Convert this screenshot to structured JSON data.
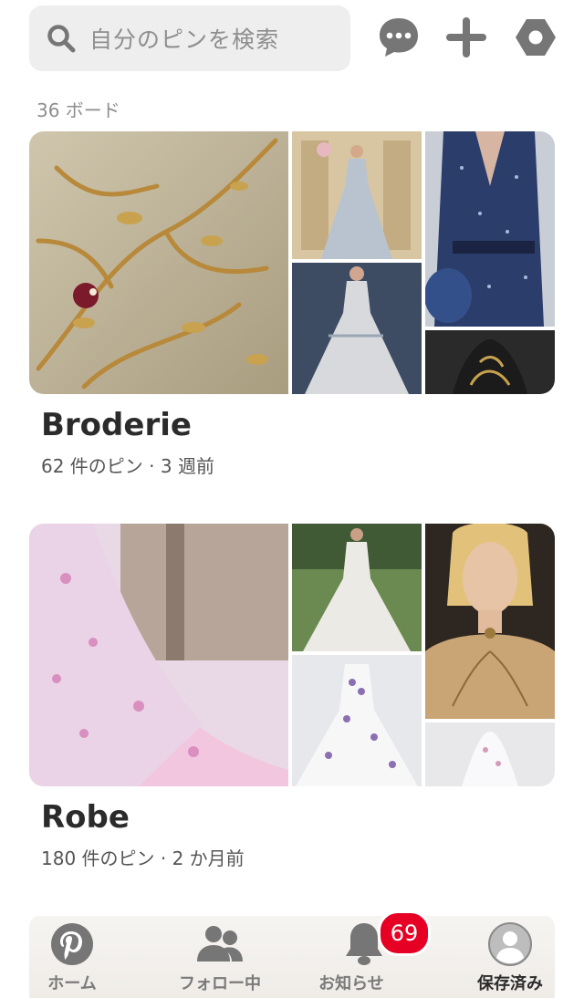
{
  "search": {
    "placeholder": "自分のピンを検索"
  },
  "header": {
    "board_count": "36 ボード"
  },
  "boards": [
    {
      "title": "Broderie",
      "meta": "62 件のピン · 3 週前"
    },
    {
      "title": "Robe",
      "meta": "180 件のピン · 2 か月前"
    }
  ],
  "nav": {
    "home": "ホーム",
    "following": "フォロー中",
    "notifications": "お知らせ",
    "saved": "保存済み",
    "badge_count": "69"
  },
  "colors": {
    "accent": "#e60023",
    "icon": "#767676",
    "background": "#ffffff"
  },
  "icons": [
    "search-icon",
    "chat-icon",
    "plus-icon",
    "settings-icon",
    "pinterest-icon",
    "following-icon",
    "bell-icon",
    "profile-icon"
  ]
}
